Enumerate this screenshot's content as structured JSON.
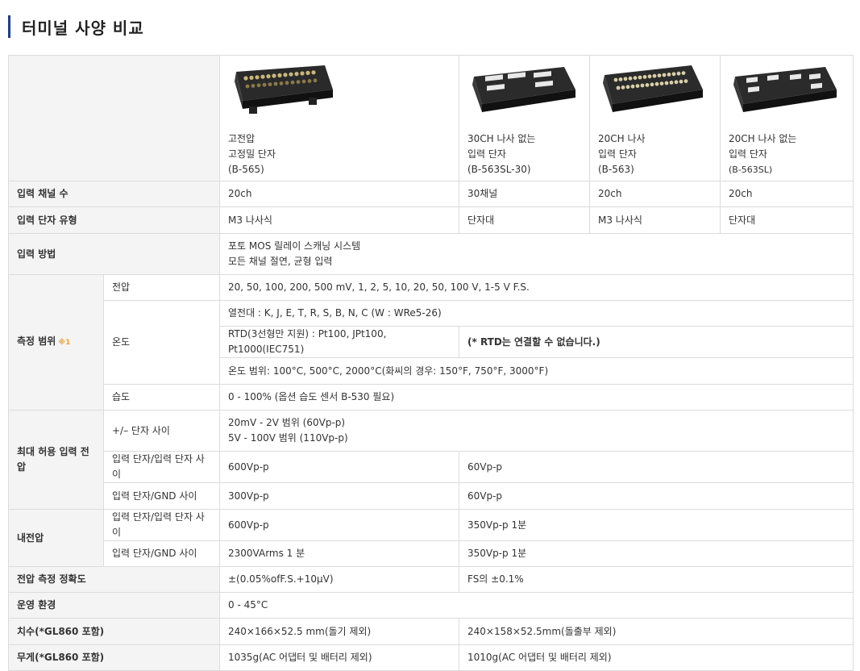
{
  "page_title": "터미널 사양 비교",
  "products": [
    {
      "lines": [
        "고전압",
        "고정밀 단자",
        "(B-565)"
      ],
      "image_icon": "terminal-block-screw-tall"
    },
    {
      "lines": [
        "30CH 나사 없는",
        "입력 단자",
        "(B-563SL-30)"
      ],
      "image_icon": "terminal-block-screwless-30"
    },
    {
      "lines": [
        "20CH 나사",
        "입력 단자",
        "(B-563)"
      ],
      "image_icon": "terminal-block-screw-20"
    },
    {
      "lines": [
        "20CH 나사 없는",
        "입력 단자",
        "(B-563SL)"
      ],
      "image_icon": "terminal-block-screwless-20"
    }
  ],
  "rows": {
    "channels": {
      "label": "입력 채널 수",
      "values": [
        "20ch",
        "30채널",
        "20ch",
        "20ch"
      ]
    },
    "terminal_type": {
      "label": "입력 단자 유형",
      "values": [
        "M3 나사식",
        "단자대",
        "M3 나사식",
        "단자대"
      ]
    },
    "input_method": {
      "label": "입력 방법",
      "lines": [
        "포토 MOS 릴레이 스캐닝 시스템",
        "모든 채널 절연, 균형 입력"
      ]
    },
    "measure_range": {
      "label": "측정 범위",
      "note": "※1",
      "voltage_label": "전압",
      "voltage_value": "20, 50, 100, 200, 500 mV, 1, 2, 5, 10, 20, 50, 100 V, 1-5 V F.S.",
      "temp_label": "온도",
      "thermocouple": "열전대 : K, J, E, T, R, S, B, N, C (W : WRe5-26)",
      "rtd": "RTD(3선형만 지원) : Pt100, JPt100, Pt1000(IEC751)",
      "rtd_note": "(* RTD는 연결할 수 없습니다.)",
      "temp_range": "온도 범위: 100°C, 500°C, 2000°C(화씨의 경우: 150°F, 750°F, 3000°F)",
      "humidity_label": "습도",
      "humidity_value": "0 - 100% (옵션 습도 센서 B-530 필요)"
    },
    "max_input": {
      "label": "최대 허용 입력 전압",
      "pm_label": "+/– 단자 사이",
      "pm_lines": [
        "20mV - 2V 범위 (60Vp-p)",
        "5V - 100V 범위 (110Vp-p)"
      ],
      "io_label": "입력 단자/입력 단자 사이",
      "io_values": [
        "600Vp-p",
        "60Vp-p"
      ],
      "gnd_label": "입력 단자/GND 사이",
      "gnd_values": [
        "300Vp-p",
        "60Vp-p"
      ]
    },
    "withstand": {
      "label": "내전압",
      "io_label": "입력 단자/입력 단자 사이",
      "io_values": [
        "600Vp-p",
        "350Vp-p 1분"
      ],
      "gnd_label": "입력 단자/GND 사이",
      "gnd_values": [
        "2300VArms 1 분",
        "350Vp-p 1분"
      ]
    },
    "accuracy": {
      "label": "전압 측정 정확도",
      "values": [
        "±(0.05%ofF.S.+10μV)",
        "FS의 ±0.1%"
      ]
    },
    "environment": {
      "label": "운영 환경",
      "value": "0 - 45°C"
    },
    "dimensions": {
      "label": "치수(*GL860 포함)",
      "values": [
        "240×166×52.5 mm(돌기 제외)",
        "240×158×52.5mm(돌출부 제외)"
      ]
    },
    "weight": {
      "label": "무게(*GL860 포함)",
      "values": [
        "1035g(AC 어댑터 및 배터리 제외)",
        "1010g(AC 어댑터 및 배터리 제외)"
      ]
    }
  },
  "colors": {
    "accent": "#1d3d8f",
    "header_bg": "#f4f4f4",
    "border": "#dcdcdc",
    "note": "#e8a23a"
  }
}
